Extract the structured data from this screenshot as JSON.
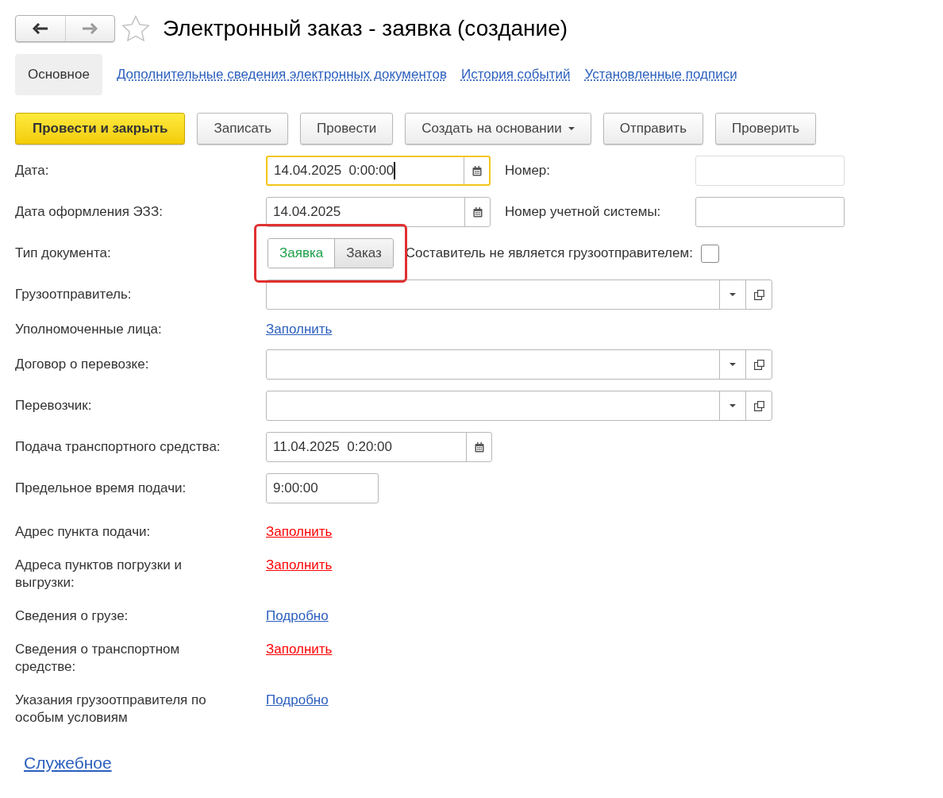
{
  "title": "Электронный заказ - заявка (создание)",
  "favorite": false,
  "tabs": [
    {
      "label": "Основное",
      "selected": true
    },
    {
      "label": "Дополнительные сведения электронных документов",
      "selected": false
    },
    {
      "label": "История событий",
      "selected": false
    },
    {
      "label": "Установленные подписи",
      "selected": false
    }
  ],
  "buttons": [
    {
      "label": "Провести и закрыть",
      "kind": "primary"
    },
    {
      "label": "Записать",
      "kind": "default"
    },
    {
      "label": "Провести",
      "kind": "default"
    },
    {
      "label": "Создать на основании",
      "kind": "menu"
    },
    {
      "label": "Отправить",
      "kind": "default"
    },
    {
      "label": "Проверить",
      "kind": "default"
    }
  ],
  "fields": [
    {
      "kind": "date",
      "label": "Дата:",
      "value": "14.04.2025  0:00:00",
      "focused": true,
      "side": {
        "label": "Номер:",
        "disabled": true
      }
    },
    {
      "kind": "date",
      "label": "Дата оформления ЭЗЗ:",
      "value": "14.04.2025",
      "focused": false,
      "side": {
        "label": "Номер учетной системы:",
        "disabled": false
      }
    },
    {
      "kind": "toggle",
      "label": "Тип документа:",
      "highlighted": true,
      "options": [
        {
          "label": "Заявка",
          "selected": true
        },
        {
          "label": "Заказ",
          "selected": false
        }
      ],
      "check": {
        "label": "Составитель не является грузоотправителем:",
        "checked": false
      }
    },
    {
      "kind": "select",
      "label": "Грузоотправитель:"
    },
    {
      "kind": "link",
      "label": "Уполномоченные лица:",
      "link": "Заполнить",
      "color": "#2b5fbd"
    },
    {
      "kind": "select",
      "label": "Договор о перевозке:"
    },
    {
      "kind": "select",
      "label": "Перевозчик:"
    },
    {
      "kind": "date",
      "label": "Подача транспортного средства:",
      "value": "11.04.2025  0:20:00",
      "focused": false
    },
    {
      "kind": "time",
      "label": "Предельное время подачи:",
      "value": "9:00:00"
    },
    {
      "kind": "link",
      "label": "Адрес пункта подачи:",
      "link": "Заполнить",
      "color": "#ff0000"
    },
    {
      "kind": "link",
      "label": "Адреса пунктов погрузки и\nвыгрузки:",
      "link": "Заполнить",
      "color": "#ff0000"
    },
    {
      "kind": "link",
      "label": "Сведения о грузе:",
      "link": "Подробно",
      "color": "#2b5fbd"
    },
    {
      "kind": "link",
      "label": "Сведения о транспортном\nсредстве:",
      "link": "Заполнить",
      "color": "#ff0000"
    },
    {
      "kind": "link",
      "label": "Указания грузоотправителя по\nособым условиям",
      "link": "Подробно",
      "color": "#2b5fbd"
    }
  ],
  "service_link": "Служебное"
}
